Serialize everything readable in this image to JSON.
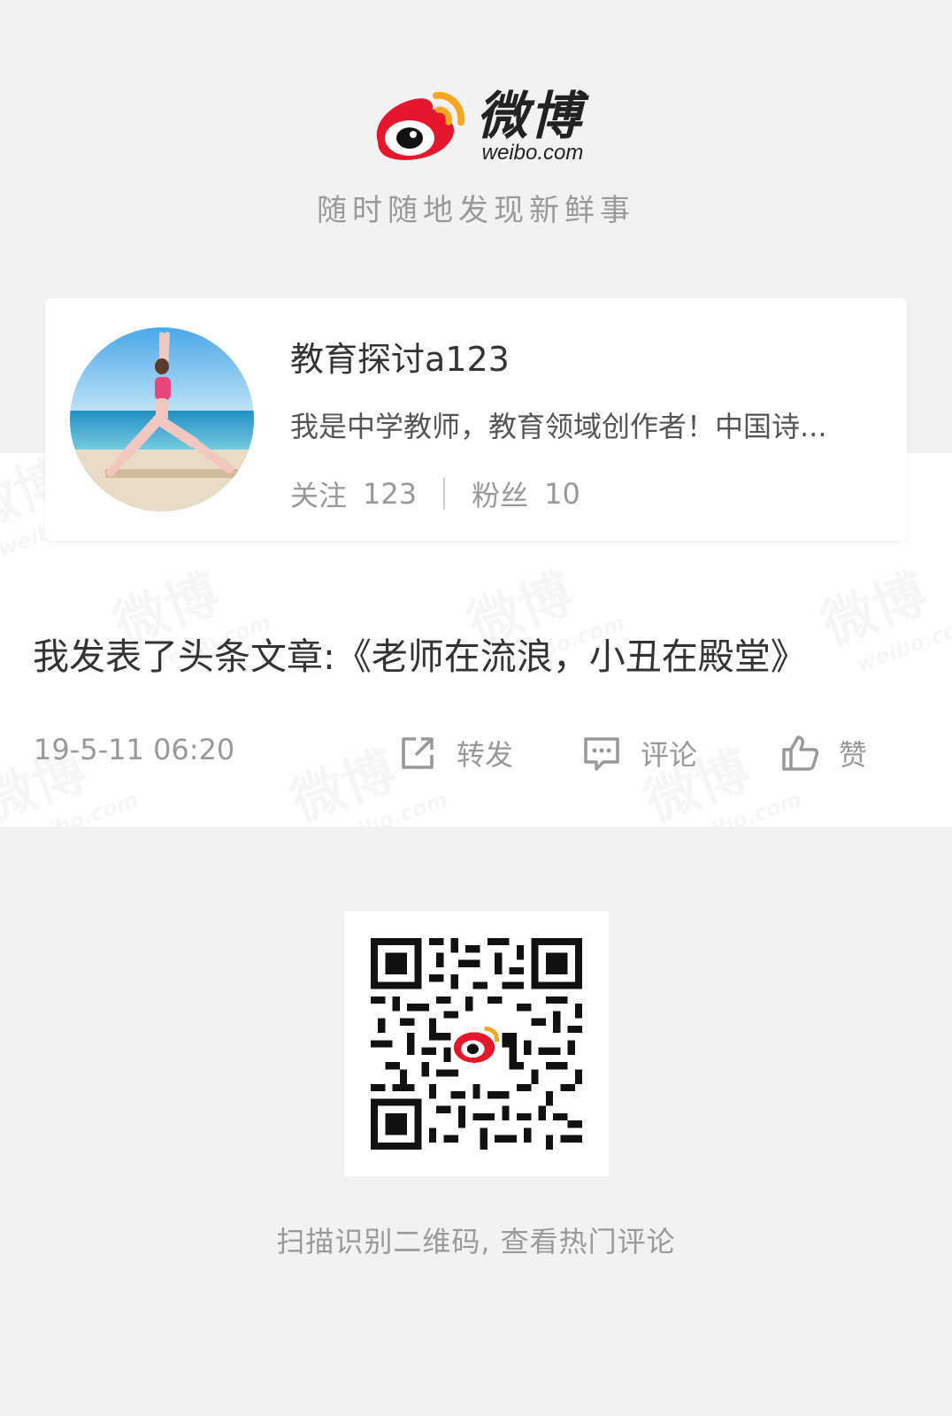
{
  "header": {
    "logo_cn": "微博",
    "logo_en": "weibo.com",
    "slogan": "随时随地发现新鲜事"
  },
  "profile": {
    "name": "教育探讨a123",
    "bio": "我是中学教师，教育领域创作者！中国诗...",
    "following_label": "关注",
    "following_count": "123",
    "followers_label": "粉丝",
    "followers_count": "10"
  },
  "post": {
    "text": "我发表了头条文章:《老师在流浪，小丑在殿堂》",
    "time": "19-5-11 06:20",
    "actions": {
      "repost": "转发",
      "comment": "评论",
      "like": "赞"
    }
  },
  "footer": {
    "scan_hint": "扫描识别二维码, 查看热门评论"
  },
  "watermark": {
    "cn": "微博",
    "en": "weibo.com"
  },
  "colors": {
    "brand_red": "#e6162d",
    "brand_orange": "#f5a623",
    "text_gray": "#999999",
    "bg": "#f2f2f5"
  }
}
